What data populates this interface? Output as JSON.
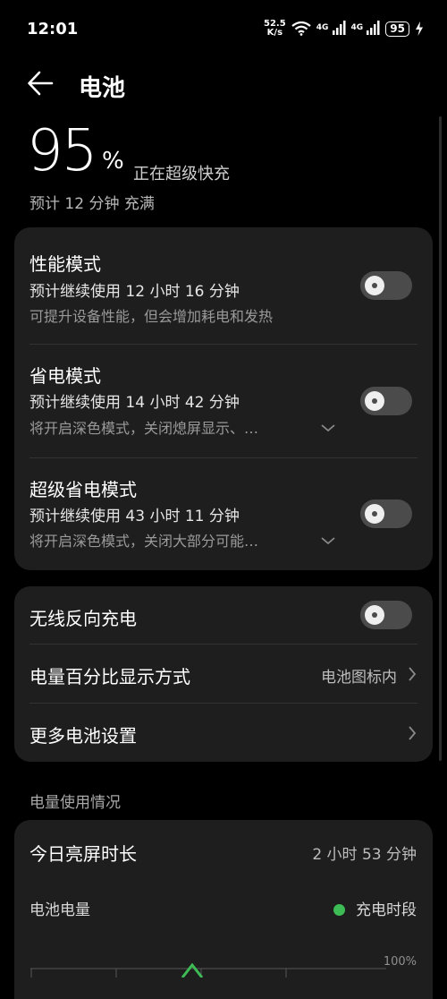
{
  "status_bar": {
    "time": "12:01",
    "net_speed_value": "52.5",
    "net_speed_unit": "K/s",
    "signal1": "4G",
    "signal2": "4G",
    "battery_level": "95"
  },
  "header": {
    "title": "电池"
  },
  "battery": {
    "percent": "95",
    "percent_sign": "%",
    "status": "正在超级快充",
    "full_estimate": "预计 12 分钟 充满"
  },
  "modes": [
    {
      "title": "性能模式",
      "estimate": "预计继续使用 12 小时 16 分钟",
      "description": "可提升设备性能，但会增加耗电和发热",
      "enabled": false
    },
    {
      "title": "省电模式",
      "estimate": "预计继续使用 14 小时 42 分钟",
      "description": "将开启深色模式，关闭熄屏显示、…",
      "enabled": false
    },
    {
      "title": "超级省电模式",
      "estimate": "预计继续使用 43 小时 11 分钟",
      "description": "将开启深色模式，关闭大部分可能…",
      "enabled": false
    }
  ],
  "settings": {
    "reverse_charging": {
      "label": "无线反向充电",
      "enabled": false
    },
    "percent_display": {
      "label": "电量百分比显示方式",
      "value": "电池图标内"
    },
    "more": {
      "label": "更多电池设置"
    }
  },
  "usage": {
    "section_title": "电量使用情况",
    "screen_time_label": "今日亮屏时长",
    "screen_time_value": "2 小时 53 分钟",
    "battery_level_label": "电池电量",
    "legend_charging": "充电时段",
    "axis_top": "100%",
    "legend_color": "#3dbb55"
  }
}
